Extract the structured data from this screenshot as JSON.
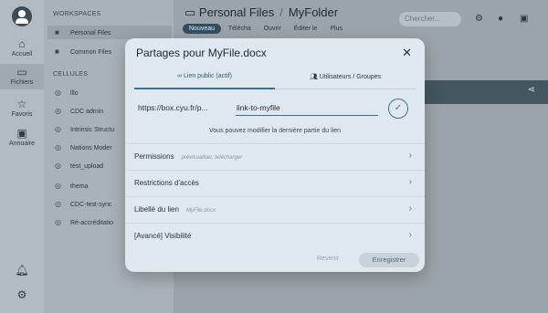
{
  "rail": {
    "items": [
      {
        "label": "Accueil",
        "icon": "home-icon",
        "glyph": "⌂"
      },
      {
        "label": "Fichiers",
        "icon": "folder-icon",
        "glyph": "▭"
      },
      {
        "label": "Favoris",
        "icon": "star-icon",
        "glyph": "☆"
      },
      {
        "label": "Annuaire",
        "icon": "contacts-icon",
        "glyph": "▣"
      }
    ],
    "bottom": [
      {
        "icon": "bell-icon",
        "glyph": "🔔︎"
      },
      {
        "icon": "settings-icon",
        "glyph": "⚙"
      }
    ]
  },
  "sidebar": {
    "workspaces_heading": "WORKSPACES",
    "workspaces": [
      {
        "label": "Personal Files",
        "selected": true
      },
      {
        "label": "Common Files",
        "selected": false
      }
    ],
    "cells_heading": "CELLULES",
    "cells": [
      "lllo",
      "CDC admin",
      "Intrinsic Structu",
      "Nations Moder",
      "test_upload",
      "thema",
      "CDC-test-sync",
      "Ré-accréditatio"
    ]
  },
  "main": {
    "breadcrumb": [
      "Personal Files",
      "MyFolder"
    ],
    "toolbar": {
      "new_label": "Nouveau",
      "items": [
        "Télécha",
        "Ouvrir",
        "Éditer le",
        "Plus"
      ]
    },
    "search_placeholder": "Chercher..."
  },
  "modal": {
    "title": "Partages pour MyFile.docx",
    "tabs": [
      {
        "label": "∞ Lien public (actif)",
        "active": true
      },
      {
        "label": "👥︎ Utilisateurs / Groupes",
        "active": false
      }
    ],
    "url_prefix": "https://box.cyu.fr/p...",
    "link_value": "link-to-myfile",
    "hint": "Vous pouvez modifier la dernière partie du lien",
    "rows": [
      {
        "label": "Permissions",
        "sub": "prévisualiser, télécharger"
      },
      {
        "label": "Restrictions d'accès",
        "sub": ""
      },
      {
        "label": "Libellé du lien",
        "sub": "MyFile.docx"
      },
      {
        "label": "[Avancé] Visibilité",
        "sub": ""
      }
    ],
    "revert_label": "Revenir",
    "save_label": "Enregistrer"
  },
  "colors": {
    "accent": "#3b6f93",
    "new_button": "#334e63"
  }
}
